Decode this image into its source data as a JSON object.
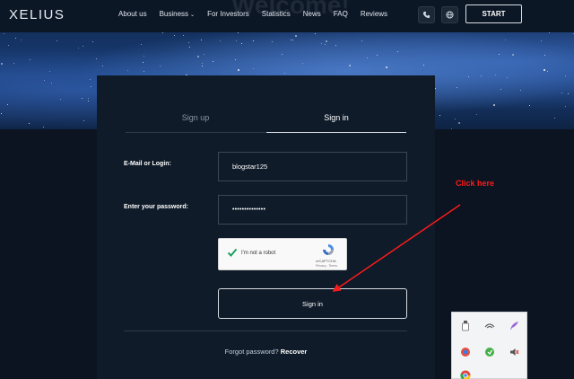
{
  "header": {
    "logo": "XELIUS",
    "nav": [
      {
        "label": "About us",
        "caret": false
      },
      {
        "label": "Business",
        "caret": true
      },
      {
        "label": "For Investors",
        "caret": false
      },
      {
        "label": "Statistics",
        "caret": false
      },
      {
        "label": "News",
        "caret": false
      },
      {
        "label": "FAQ",
        "caret": false
      },
      {
        "label": "Reviews",
        "caret": false
      }
    ],
    "phone_icon": "phone-icon",
    "globe_icon": "globe-icon",
    "start_label": "START",
    "ghost_title": "Welcome!"
  },
  "login": {
    "tabs": {
      "signup": "Sign up",
      "signin": "Sign in"
    },
    "email_label": "E-Mail or Login:",
    "email_value": "blogstar125",
    "password_label": "Enter your password:",
    "password_value": "••••••••••••••",
    "captcha": {
      "text": "I'm not a robot",
      "brand": "reCAPTCHA",
      "terms": "Privacy - Terms"
    },
    "signin_button": "Sign in",
    "forgot_text": "Forgot password?",
    "recover_link": "Recover"
  },
  "annotation": {
    "text": "Click here",
    "color": "#ff1a1a"
  },
  "colors": {
    "background": "#0b1420",
    "card": "#0f1b29",
    "annotation": "#ff1a1a"
  }
}
